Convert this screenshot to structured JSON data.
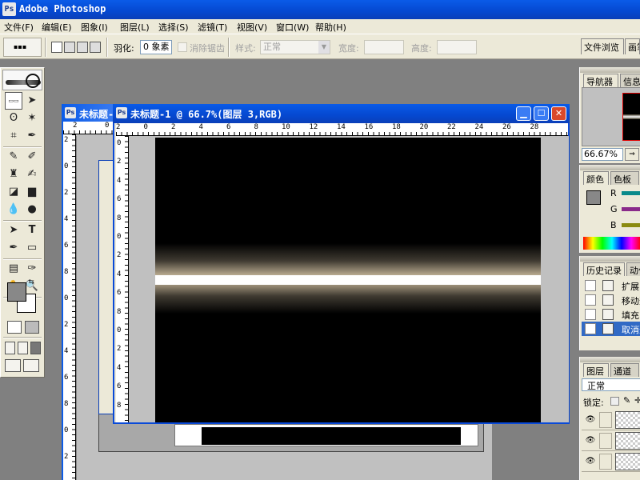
{
  "app": {
    "title": "Adobe Photoshop",
    "icon": "photoshop-icon"
  },
  "menu": [
    "文件(F)",
    "编辑(E)",
    "图象(I)",
    "图层(L)",
    "选择(S)",
    "滤镜(T)",
    "视图(V)",
    "窗口(W)",
    "帮助(H)"
  ],
  "options": {
    "tool_preset": "▪▪▪",
    "feather_label": "羽化:",
    "feather_value": "0 象素",
    "antialias_label": "消除锯齿",
    "style_label": "样式:",
    "style_value": "正常",
    "width_label": "宽度:",
    "height_label": "高度:"
  },
  "palette_well": {
    "file_browser": "文件浏览",
    "brushes": "画笔"
  },
  "toolbox": {
    "active_tool_label": "▭▭",
    "foreground_color": "#888888",
    "background_color": "#ffffff"
  },
  "doc_back": {
    "title": "未标题-1",
    "ruler_x": [
      "2",
      "0"
    ],
    "ruler_y": [
      "2",
      "0",
      "2",
      "4",
      "6",
      "8",
      "0",
      "2",
      "4",
      "6",
      "8",
      "0",
      "2"
    ]
  },
  "doc_front": {
    "title": "未标题-1 @ 66.7%(图层 3,RGB)",
    "ruler_x": [
      "2",
      "0",
      "2",
      "4",
      "6",
      "8",
      "10",
      "12",
      "14",
      "16",
      "18",
      "20",
      "22",
      "24",
      "26",
      "28"
    ],
    "ruler_y": [
      "0",
      "2",
      "4",
      "6",
      "8",
      "0",
      "2",
      "4",
      "6",
      "8",
      "0",
      "2",
      "4",
      "6",
      "8"
    ],
    "canvas_color": "#000000",
    "glow_color": "#bdae93"
  },
  "navigator": {
    "tab_nav": "导航器",
    "tab_info": "信息",
    "zoom": "66.67%"
  },
  "color": {
    "tab_color": "颜色",
    "tab_swatches": "色板",
    "r": "R",
    "g": "G",
    "b": "B"
  },
  "history": {
    "tab_history": "历史记录",
    "tab_actions": "动作",
    "items": [
      "扩展",
      "移动选区",
      "填充",
      "取消选择"
    ]
  },
  "layers": {
    "tab_layers": "图层",
    "tab_channels": "通道",
    "blend": "正常",
    "lock_label": "锁定:"
  }
}
